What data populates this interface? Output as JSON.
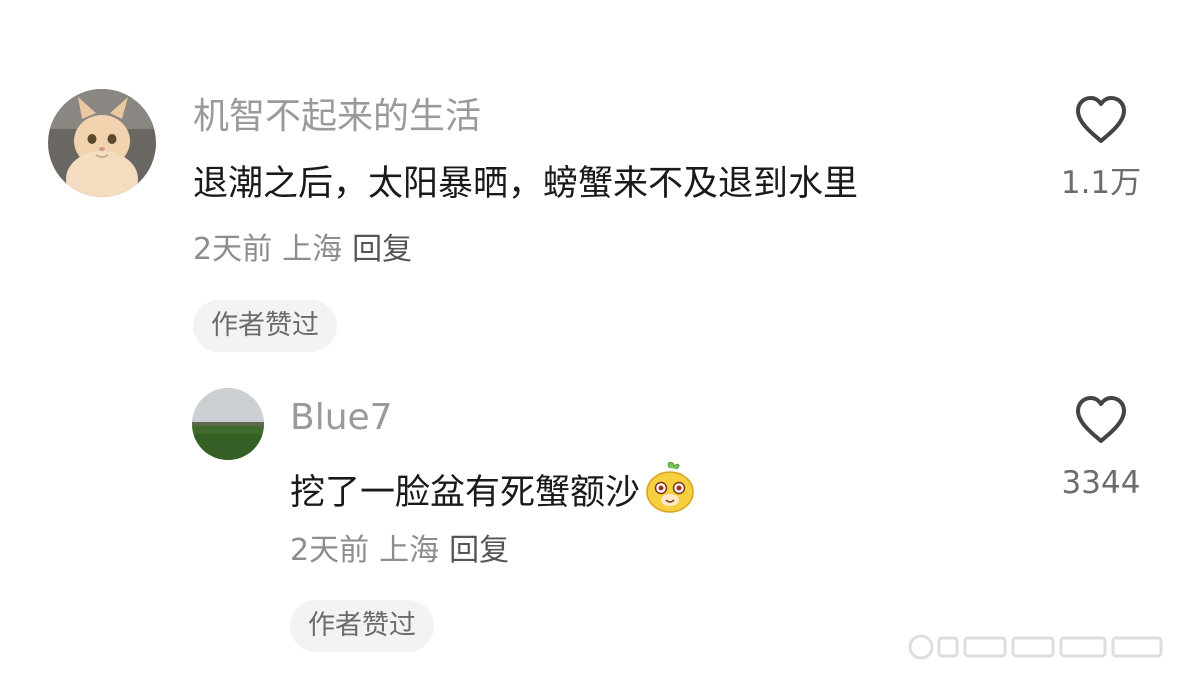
{
  "comments": [
    {
      "username": "机智不起来的生活",
      "text": "退潮之后，太阳暴晒，螃蟹来不及退到水里",
      "time": "2天前",
      "location": "上海",
      "reply_label": "回复",
      "badge": "作者赞过",
      "likes": "1.1万",
      "avatar_icon": "cat-avatar-icon",
      "like_icon": "heart-outline-icon"
    },
    {
      "username": "Blue7",
      "text": "挖了一脸盆有死蟹额沙",
      "emoji_icon": "cute-face-emoji-icon",
      "time": "2天前",
      "location": "上海",
      "reply_label": "回复",
      "badge": "作者赞过",
      "likes": "3344",
      "avatar_icon": "landscape-avatar-icon",
      "like_icon": "heart-outline-icon"
    }
  ],
  "colors": {
    "username": "#9a9a9a",
    "text": "#1a1a1a",
    "meta": "#8d8d8d",
    "badge_bg": "#f3f3f3",
    "heart": "#444444"
  }
}
